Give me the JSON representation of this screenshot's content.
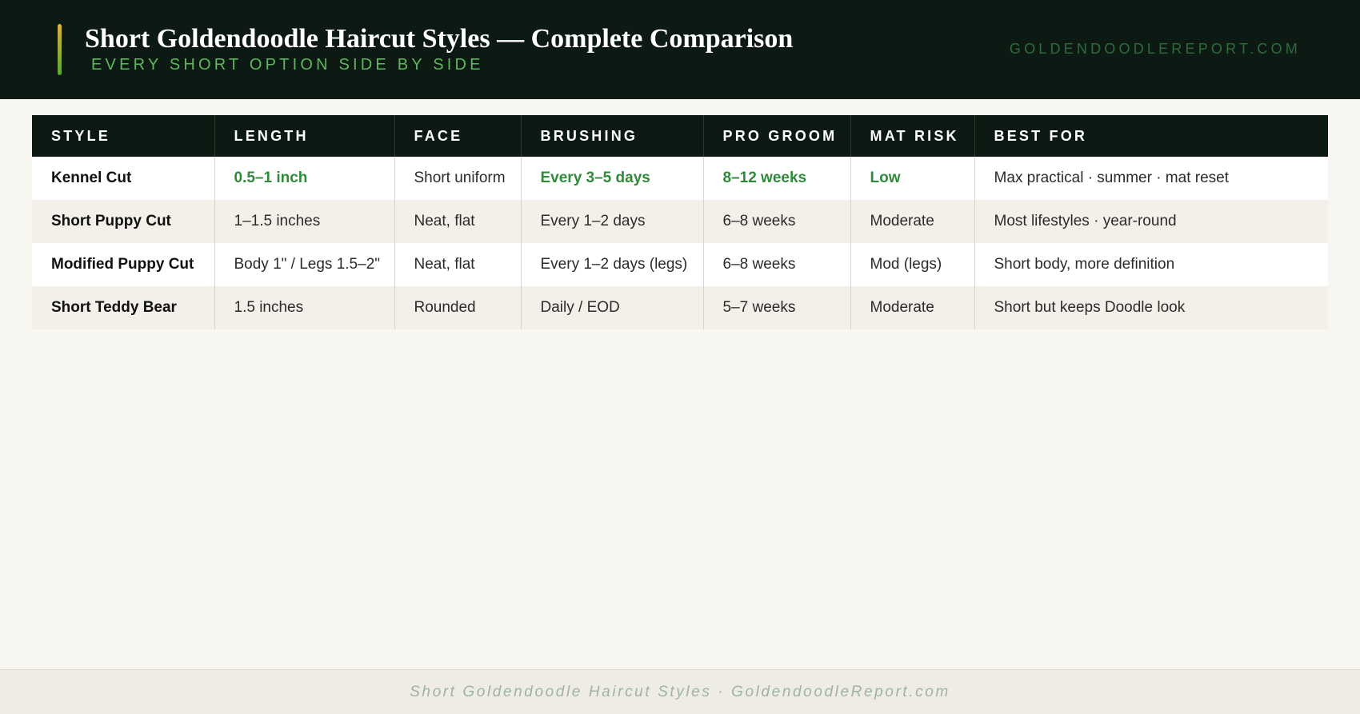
{
  "header": {
    "title": "Short Goldendoodle Haircut Styles — Complete Comparison",
    "subtitle": "EVERY SHORT OPTION SIDE BY SIDE",
    "site": "GOLDENDOODLEREPORT.COM"
  },
  "table": {
    "columns": [
      "STYLE",
      "LENGTH",
      "FACE",
      "BRUSHING",
      "PRO GROOM",
      "MAT RISK",
      "BEST FOR"
    ],
    "rows": [
      [
        "Kennel Cut",
        "0.5–1 inch",
        "Short uniform",
        "Every 3–5 days",
        "8–12 weeks",
        "Low",
        "Max practical · summer · mat reset"
      ],
      [
        "Short Puppy Cut",
        "1–1.5 inches",
        "Neat, flat",
        "Every 1–2 days",
        "6–8 weeks",
        "Moderate",
        "Most lifestyles · year-round"
      ],
      [
        "Modified Puppy Cut",
        "Body 1\" / Legs 1.5–2\"",
        "Neat, flat",
        "Every 1–2 days (legs)",
        "6–8 weeks",
        "Mod (legs)",
        "Short body, more definition"
      ],
      [
        "Short Teddy Bear",
        "1.5 inches",
        "Rounded",
        "Daily / EOD",
        "5–7 weeks",
        "Moderate",
        "Short but keeps Doodle look"
      ]
    ],
    "highlight_color": "#2e8b3a"
  },
  "footer": {
    "text": "Short Goldendoodle Haircut Styles · GoldendoodleReport.com"
  }
}
